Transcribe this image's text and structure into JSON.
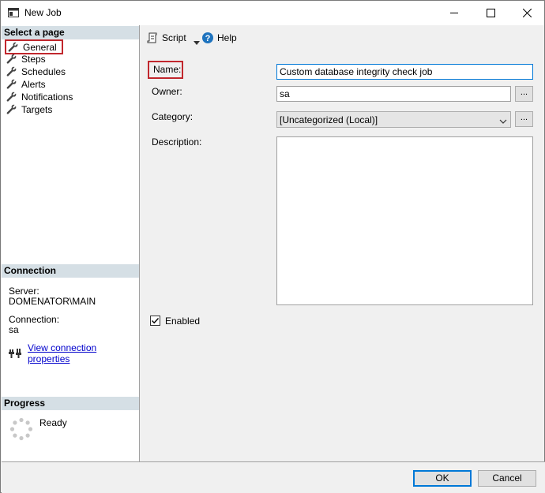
{
  "window": {
    "title": "New Job"
  },
  "left": {
    "select_page_header": "Select a page",
    "pages": [
      {
        "label": "General"
      },
      {
        "label": "Steps"
      },
      {
        "label": "Schedules"
      },
      {
        "label": "Alerts"
      },
      {
        "label": "Notifications"
      },
      {
        "label": "Targets"
      }
    ],
    "connection_header": "Connection",
    "server_label": "Server:",
    "server_value": "DOMENATOR\\MAIN",
    "connection_label": "Connection:",
    "connection_value": "sa",
    "view_connection_link": "View connection properties",
    "progress_header": "Progress",
    "progress_status": "Ready"
  },
  "toolbar": {
    "script_label": "Script",
    "help_label": "Help"
  },
  "form": {
    "name_label": "Name:",
    "name_value": "Custom database integrity check job",
    "owner_label": "Owner:",
    "owner_value": "sa",
    "category_label": "Category:",
    "category_value": "[Uncategorized (Local)]",
    "description_label": "Description:",
    "description_value": "",
    "browse_label": "...",
    "enabled_label": "Enabled",
    "enabled_checked": true
  },
  "buttons": {
    "ok_label": "OK",
    "cancel_label": "Cancel"
  },
  "colors": {
    "highlight_border": "#c1272d",
    "focus_blue": "#0078d7",
    "link_blue": "#0000cc",
    "section_header_bg": "#d5dfe5"
  },
  "icons": {
    "app": "window-icon",
    "page_items": "wrench-icon",
    "script": "script-icon",
    "help": "help-icon",
    "connection": "connection-plug-icon",
    "progress": "spinner-icon"
  }
}
